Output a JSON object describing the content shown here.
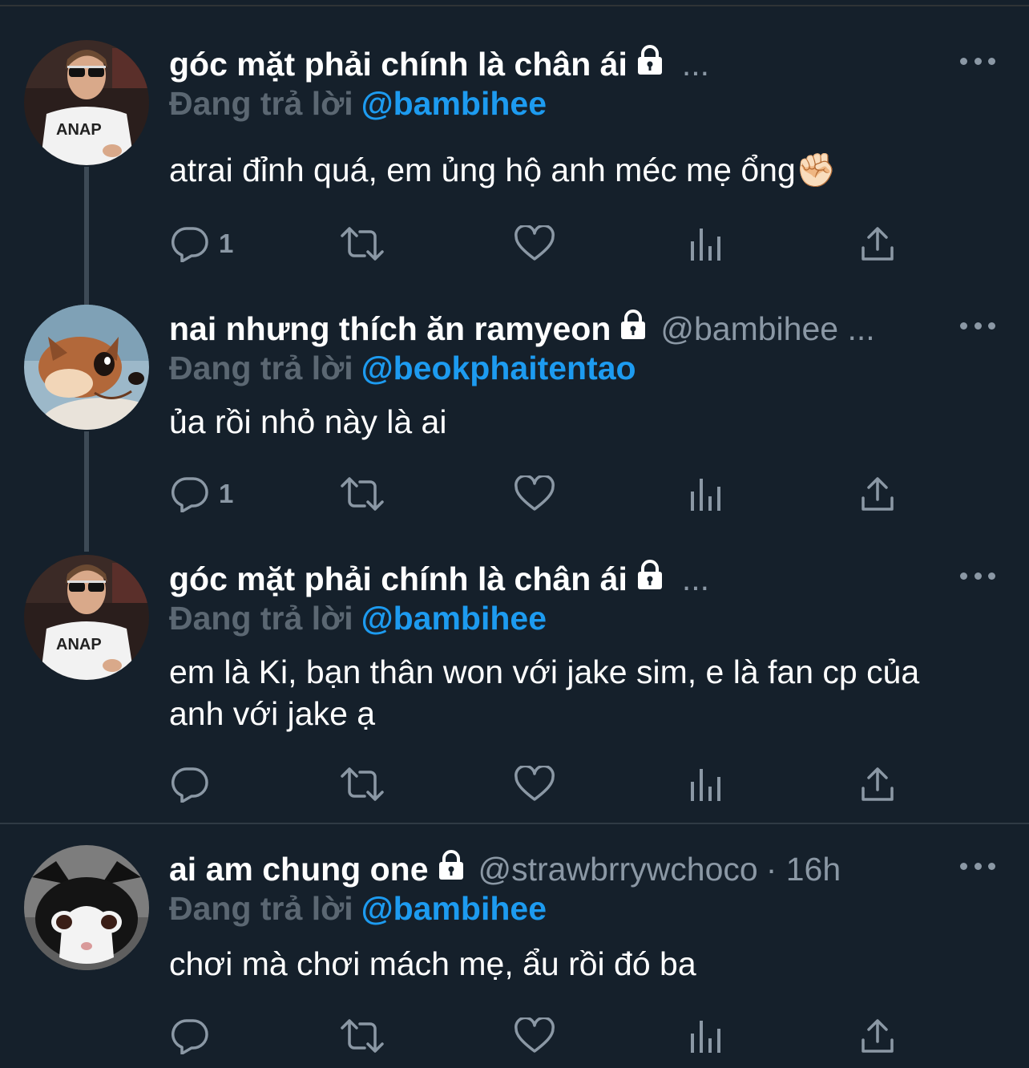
{
  "tweets": [
    {
      "name": "góc mặt phải chính là chân ái",
      "handle": "",
      "time": "",
      "trailing": "...",
      "replying_label": "Đang trả lời",
      "mention": "@bambihee",
      "text": "atrai đỉnh quá, em ủng hộ anh méc mẹ ổng✊🏻",
      "reply_count": "1",
      "avatar": "boy-sunglasses-anap-shirt",
      "locked": true
    },
    {
      "name": "nai nhưng thích ăn ramyeon",
      "handle": "@bambihee ...",
      "time": "",
      "trailing": "",
      "replying_label": "Đang trả lời",
      "mention": "@beokphaitentao",
      "text": "ủa rồi nhỏ này là ai",
      "reply_count": "1",
      "avatar": "cartoon-fawn",
      "locked": true
    },
    {
      "name": "góc mặt phải chính là chân ái",
      "handle": "",
      "time": "",
      "trailing": "...",
      "replying_label": "Đang trả lời",
      "mention": "@bambihee",
      "text": "em là Ki, bạn thân won với jake sim, e là fan cp của anh với jake ạ",
      "reply_count": "",
      "avatar": "boy-sunglasses-anap-shirt",
      "locked": true
    },
    {
      "name": "ai am chung one",
      "handle": "@strawbrrywchoco",
      "time": "· 16h",
      "trailing": "",
      "replying_label": "Đang trả lời",
      "mention": "@bambihee",
      "text": "chơi mà chơi mách mẹ, ẩu rồi đó ba",
      "reply_count": "",
      "avatar": "black-white-cat",
      "locked": true
    }
  ],
  "icons": {
    "reply": "reply-icon",
    "retweet": "retweet-icon",
    "like": "like-icon",
    "views": "views-icon",
    "share": "share-icon",
    "lock": "lock-icon",
    "more": "more-icon"
  },
  "colors": {
    "background": "#15202b",
    "mention": "#1d9bf0",
    "secondary": "#8b98a5",
    "replying_label": "#5b6772"
  }
}
